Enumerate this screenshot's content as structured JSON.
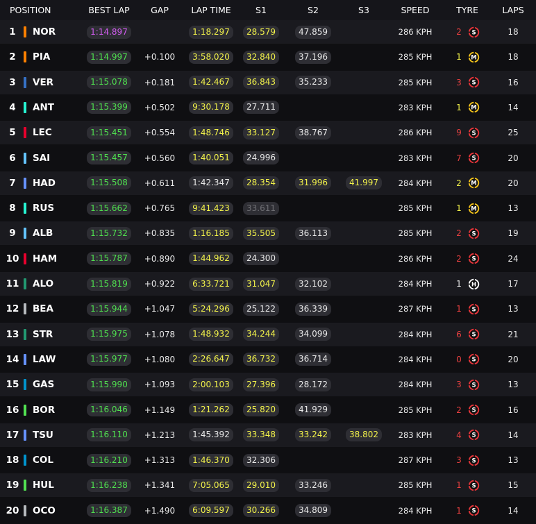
{
  "headers": {
    "position": "POSITION",
    "best_lap": "BEST LAP",
    "gap": "GAP",
    "lap_time": "LAP TIME",
    "s1": "S1",
    "s2": "S2",
    "s3": "S3",
    "speed": "SPEED",
    "tyre": "TYRE",
    "laps": "LAPS"
  },
  "colors": {
    "purple": "#d25cf0",
    "green": "#4fe04f",
    "yellow": "#f2f24a",
    "white": "#e8e8e8",
    "grey": "#6f6f74",
    "red_num": "#e84040",
    "tyre_soft": "#e8353a",
    "tyre_medium": "#f2c21b",
    "tyre_hard": "#ffffff"
  },
  "rows": [
    {
      "pos": "1",
      "code": "NOR",
      "team_color": "#ff8000",
      "best_lap": "1:14.897",
      "best_lap_color": "purple",
      "gap": "",
      "lap_time": "1:18.297",
      "lap_time_color": "yellow",
      "s1": "28.579",
      "s1_color": "yellow",
      "s2": "47.859",
      "s2_color": "white",
      "s3": "",
      "s3_color": "",
      "speed": "286 KPH",
      "tyre_age": "2",
      "tyre_age_color": "red_num",
      "tyre": "S",
      "laps": "18"
    },
    {
      "pos": "2",
      "code": "PIA",
      "team_color": "#ff8000",
      "best_lap": "1:14.997",
      "best_lap_color": "green",
      "gap": "+0.100",
      "lap_time": "3:58.020",
      "lap_time_color": "yellow",
      "s1": "32.840",
      "s1_color": "yellow",
      "s2": "37.196",
      "s2_color": "white",
      "s3": "",
      "s3_color": "",
      "speed": "285 KPH",
      "tyre_age": "1",
      "tyre_age_color": "yellow",
      "tyre": "M",
      "laps": "18"
    },
    {
      "pos": "3",
      "code": "VER",
      "team_color": "#3671c6",
      "best_lap": "1:15.078",
      "best_lap_color": "green",
      "gap": "+0.181",
      "lap_time": "1:42.467",
      "lap_time_color": "yellow",
      "s1": "36.843",
      "s1_color": "yellow",
      "s2": "35.233",
      "s2_color": "white",
      "s3": "",
      "s3_color": "",
      "speed": "285 KPH",
      "tyre_age": "3",
      "tyre_age_color": "red_num",
      "tyre": "S",
      "laps": "16"
    },
    {
      "pos": "4",
      "code": "ANT",
      "team_color": "#27f4d2",
      "best_lap": "1:15.399",
      "best_lap_color": "green",
      "gap": "+0.502",
      "lap_time": "9:30.178",
      "lap_time_color": "yellow",
      "s1": "27.711",
      "s1_color": "white",
      "s2": "",
      "s2_color": "",
      "s3": "",
      "s3_color": "",
      "speed": "283 KPH",
      "tyre_age": "1",
      "tyre_age_color": "yellow",
      "tyre": "M",
      "laps": "14"
    },
    {
      "pos": "5",
      "code": "LEC",
      "team_color": "#e8002d",
      "best_lap": "1:15.451",
      "best_lap_color": "green",
      "gap": "+0.554",
      "lap_time": "1:48.746",
      "lap_time_color": "yellow",
      "s1": "33.127",
      "s1_color": "yellow",
      "s2": "38.767",
      "s2_color": "white",
      "s3": "",
      "s3_color": "",
      "speed": "286 KPH",
      "tyre_age": "9",
      "tyre_age_color": "red_num",
      "tyre": "S",
      "laps": "25"
    },
    {
      "pos": "6",
      "code": "SAI",
      "team_color": "#64c4ff",
      "best_lap": "1:15.457",
      "best_lap_color": "green",
      "gap": "+0.560",
      "lap_time": "1:40.051",
      "lap_time_color": "yellow",
      "s1": "24.996",
      "s1_color": "white",
      "s2": "",
      "s2_color": "",
      "s3": "",
      "s3_color": "",
      "speed": "283 KPH",
      "tyre_age": "7",
      "tyre_age_color": "red_num",
      "tyre": "S",
      "laps": "20"
    },
    {
      "pos": "7",
      "code": "HAD",
      "team_color": "#6692ff",
      "best_lap": "1:15.508",
      "best_lap_color": "green",
      "gap": "+0.611",
      "lap_time": "1:42.347",
      "lap_time_color": "white",
      "s1": "28.354",
      "s1_color": "yellow",
      "s2": "31.996",
      "s2_color": "yellow",
      "s3": "41.997",
      "s3_color": "yellow",
      "speed": "284 KPH",
      "tyre_age": "2",
      "tyre_age_color": "yellow",
      "tyre": "M",
      "laps": "20"
    },
    {
      "pos": "8",
      "code": "RUS",
      "team_color": "#27f4d2",
      "best_lap": "1:15.662",
      "best_lap_color": "green",
      "gap": "+0.765",
      "lap_time": "9:41.423",
      "lap_time_color": "yellow",
      "s1": "33.611",
      "s1_color": "grey",
      "s2": "",
      "s2_color": "",
      "s3": "",
      "s3_color": "",
      "speed": "285 KPH",
      "tyre_age": "1",
      "tyre_age_color": "yellow",
      "tyre": "M",
      "laps": "13"
    },
    {
      "pos": "9",
      "code": "ALB",
      "team_color": "#64c4ff",
      "best_lap": "1:15.732",
      "best_lap_color": "green",
      "gap": "+0.835",
      "lap_time": "1:16.185",
      "lap_time_color": "yellow",
      "s1": "35.505",
      "s1_color": "yellow",
      "s2": "36.113",
      "s2_color": "white",
      "s3": "",
      "s3_color": "",
      "speed": "285 KPH",
      "tyre_age": "2",
      "tyre_age_color": "red_num",
      "tyre": "S",
      "laps": "19"
    },
    {
      "pos": "10",
      "code": "HAM",
      "team_color": "#e8002d",
      "best_lap": "1:15.787",
      "best_lap_color": "green",
      "gap": "+0.890",
      "lap_time": "1:44.962",
      "lap_time_color": "yellow",
      "s1": "24.300",
      "s1_color": "white",
      "s2": "",
      "s2_color": "",
      "s3": "",
      "s3_color": "",
      "speed": "286 KPH",
      "tyre_age": "2",
      "tyre_age_color": "red_num",
      "tyre": "S",
      "laps": "24"
    },
    {
      "pos": "11",
      "code": "ALO",
      "team_color": "#229971",
      "best_lap": "1:15.819",
      "best_lap_color": "green",
      "gap": "+0.922",
      "lap_time": "6:33.721",
      "lap_time_color": "yellow",
      "s1": "31.047",
      "s1_color": "yellow",
      "s2": "32.102",
      "s2_color": "white",
      "s3": "",
      "s3_color": "",
      "speed": "284 KPH",
      "tyre_age": "1",
      "tyre_age_color": "white",
      "tyre": "H",
      "laps": "17"
    },
    {
      "pos": "12",
      "code": "BEA",
      "team_color": "#b6babd",
      "best_lap": "1:15.944",
      "best_lap_color": "green",
      "gap": "+1.047",
      "lap_time": "5:24.296",
      "lap_time_color": "yellow",
      "s1": "25.122",
      "s1_color": "white",
      "s2": "36.339",
      "s2_color": "white",
      "s3": "",
      "s3_color": "",
      "speed": "287 KPH",
      "tyre_age": "1",
      "tyre_age_color": "red_num",
      "tyre": "S",
      "laps": "13"
    },
    {
      "pos": "13",
      "code": "STR",
      "team_color": "#229971",
      "best_lap": "1:15.975",
      "best_lap_color": "green",
      "gap": "+1.078",
      "lap_time": "1:48.932",
      "lap_time_color": "yellow",
      "s1": "34.244",
      "s1_color": "yellow",
      "s2": "34.099",
      "s2_color": "white",
      "s3": "",
      "s3_color": "",
      "speed": "284 KPH",
      "tyre_age": "6",
      "tyre_age_color": "red_num",
      "tyre": "S",
      "laps": "21"
    },
    {
      "pos": "14",
      "code": "LAW",
      "team_color": "#6692ff",
      "best_lap": "1:15.977",
      "best_lap_color": "green",
      "gap": "+1.080",
      "lap_time": "2:26.647",
      "lap_time_color": "yellow",
      "s1": "36.732",
      "s1_color": "yellow",
      "s2": "36.714",
      "s2_color": "white",
      "s3": "",
      "s3_color": "",
      "speed": "284 KPH",
      "tyre_age": "0",
      "tyre_age_color": "red_num",
      "tyre": "S",
      "laps": "20"
    },
    {
      "pos": "15",
      "code": "GAS",
      "team_color": "#0093cc",
      "best_lap": "1:15.990",
      "best_lap_color": "green",
      "gap": "+1.093",
      "lap_time": "2:00.103",
      "lap_time_color": "yellow",
      "s1": "27.396",
      "s1_color": "yellow",
      "s2": "28.172",
      "s2_color": "white",
      "s3": "",
      "s3_color": "",
      "speed": "284 KPH",
      "tyre_age": "3",
      "tyre_age_color": "red_num",
      "tyre": "S",
      "laps": "13"
    },
    {
      "pos": "16",
      "code": "BOR",
      "team_color": "#52e252",
      "best_lap": "1:16.046",
      "best_lap_color": "green",
      "gap": "+1.149",
      "lap_time": "1:21.262",
      "lap_time_color": "yellow",
      "s1": "25.820",
      "s1_color": "yellow",
      "s2": "41.929",
      "s2_color": "white",
      "s3": "",
      "s3_color": "",
      "speed": "285 KPH",
      "tyre_age": "2",
      "tyre_age_color": "red_num",
      "tyre": "S",
      "laps": "16"
    },
    {
      "pos": "17",
      "code": "TSU",
      "team_color": "#6692ff",
      "best_lap": "1:16.110",
      "best_lap_color": "green",
      "gap": "+1.213",
      "lap_time": "1:45.392",
      "lap_time_color": "white",
      "s1": "33.348",
      "s1_color": "yellow",
      "s2": "33.242",
      "s2_color": "yellow",
      "s3": "38.802",
      "s3_color": "yellow",
      "speed": "283 KPH",
      "tyre_age": "4",
      "tyre_age_color": "red_num",
      "tyre": "S",
      "laps": "14"
    },
    {
      "pos": "18",
      "code": "COL",
      "team_color": "#0093cc",
      "best_lap": "1:16.210",
      "best_lap_color": "green",
      "gap": "+1.313",
      "lap_time": "1:46.370",
      "lap_time_color": "yellow",
      "s1": "32.306",
      "s1_color": "white",
      "s2": "",
      "s2_color": "",
      "s3": "",
      "s3_color": "",
      "speed": "287 KPH",
      "tyre_age": "3",
      "tyre_age_color": "red_num",
      "tyre": "S",
      "laps": "13"
    },
    {
      "pos": "19",
      "code": "HUL",
      "team_color": "#52e252",
      "best_lap": "1:16.238",
      "best_lap_color": "green",
      "gap": "+1.341",
      "lap_time": "7:05.065",
      "lap_time_color": "yellow",
      "s1": "29.010",
      "s1_color": "yellow",
      "s2": "33.246",
      "s2_color": "white",
      "s3": "",
      "s3_color": "",
      "speed": "285 KPH",
      "tyre_age": "1",
      "tyre_age_color": "red_num",
      "tyre": "S",
      "laps": "15"
    },
    {
      "pos": "20",
      "code": "OCO",
      "team_color": "#b6babd",
      "best_lap": "1:16.387",
      "best_lap_color": "green",
      "gap": "+1.490",
      "lap_time": "6:09.597",
      "lap_time_color": "yellow",
      "s1": "30.266",
      "s1_color": "yellow",
      "s2": "34.809",
      "s2_color": "white",
      "s3": "",
      "s3_color": "",
      "speed": "284 KPH",
      "tyre_age": "1",
      "tyre_age_color": "red_num",
      "tyre": "S",
      "laps": "14"
    }
  ]
}
